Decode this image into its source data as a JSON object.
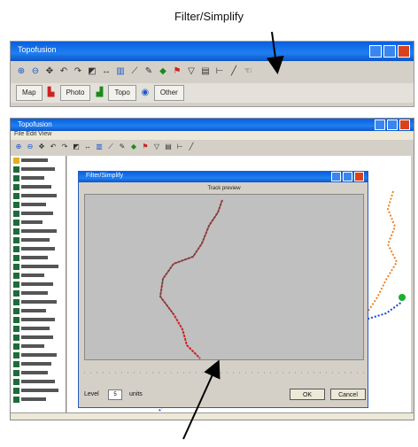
{
  "annotations": {
    "top_caption": "Filter/Simplify"
  },
  "top_window": {
    "title": "Topofusion",
    "toolbar_icons": [
      "zoom-in-icon",
      "zoom-out-icon",
      "pan-icon",
      "undo-icon",
      "redo-icon",
      "select-icon",
      "measure-icon",
      "chart-icon",
      "route-icon",
      "pencil-icon",
      "flag-icon",
      "filter-simplify-icon",
      "trash-icon",
      "split-icon",
      "line-icon",
      "hand-icon"
    ],
    "tabs": [
      "Map",
      "Photo",
      "Topo",
      "Other"
    ],
    "colors": {
      "title_blue": "#1f7ff0",
      "close_red": "#d9421f"
    }
  },
  "main_window": {
    "title": "Topofusion",
    "menu": "File Edit View",
    "dialog": {
      "title": "Filter/Simplify",
      "track_label": "Track preview",
      "slider_label": "Level",
      "field_value": "5",
      "units_label": "units",
      "ok_label": "OK",
      "cancel_label": "Cancel"
    },
    "colors": {
      "track_red": "#d22020",
      "track_orange": "#f08020",
      "track_blue": "#1a3fd8",
      "point_green": "#18b030",
      "plot_gray": "#c0c0c0"
    }
  }
}
